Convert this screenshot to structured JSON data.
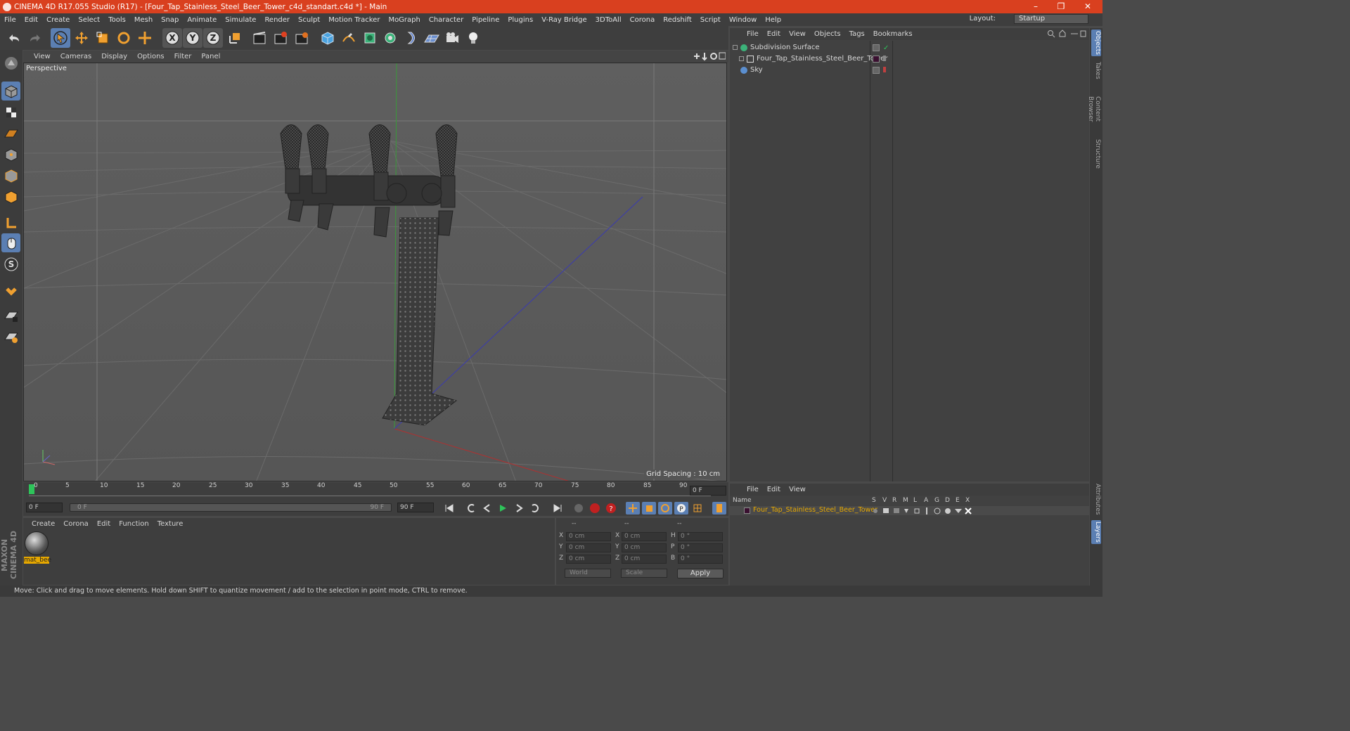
{
  "titlebar": {
    "title": "CINEMA 4D R17.055 Studio (R17) - [Four_Tap_Stainless_Steel_Beer_Tower_c4d_standart.c4d *] - Main",
    "minimize": "–",
    "restore": "❐",
    "close": "✕"
  },
  "menubar": {
    "items": [
      "File",
      "Edit",
      "Create",
      "Select",
      "Tools",
      "Mesh",
      "Snap",
      "Animate",
      "Simulate",
      "Render",
      "Sculpt",
      "Motion Tracker",
      "MoGraph",
      "Character",
      "Pipeline",
      "Plugins",
      "V-Ray Bridge",
      "3DToAll",
      "Corona",
      "Redshift",
      "Script",
      "Window",
      "Help"
    ],
    "layout_label": "Layout:",
    "layout_value": "Startup"
  },
  "toolbar": {
    "axis_x": "X",
    "axis_y": "Y",
    "axis_z": "Z"
  },
  "viewport": {
    "menu": [
      "View",
      "Cameras",
      "Display",
      "Options",
      "Filter",
      "Panel"
    ],
    "label": "Perspective",
    "grid_spacing": "Grid Spacing : 10 cm"
  },
  "timeline": {
    "ticks": [
      "0",
      "5",
      "10",
      "15",
      "20",
      "25",
      "30",
      "35",
      "40",
      "45",
      "50",
      "55",
      "60",
      "65",
      "70",
      "75",
      "80",
      "85",
      "90"
    ],
    "current_frame": "0 F",
    "start_frame": "0 F",
    "range_start": "0 F",
    "range_end": "90 F",
    "end_frame": "90 F"
  },
  "material_manager": {
    "menu": [
      "Create",
      "Corona",
      "Edit",
      "Function",
      "Texture"
    ],
    "material_name": "mat_bee"
  },
  "coordinates": {
    "header_left": "--",
    "header_mid": "--",
    "header_right": "--",
    "rows": [
      {
        "l1": "X",
        "v1": "0 cm",
        "l2": "X",
        "v2": "0 cm",
        "l3": "H",
        "v3": "0 °"
      },
      {
        "l1": "Y",
        "v1": "0 cm",
        "l2": "Y",
        "v2": "0 cm",
        "l3": "P",
        "v3": "0 °"
      },
      {
        "l1": "Z",
        "v1": "0 cm",
        "l2": "Z",
        "v2": "0 cm",
        "l3": "B",
        "v3": "0 °"
      }
    ],
    "coord_system": "World",
    "mode": "Scale",
    "apply": "Apply"
  },
  "object_manager": {
    "menu": [
      "File",
      "Edit",
      "View",
      "Objects",
      "Tags",
      "Bookmarks"
    ],
    "objects": [
      {
        "name": "Subdivision Surface",
        "indent": 0
      },
      {
        "name": "Four_Tap_Stainless_Steel_Beer_Tower",
        "indent": 1
      },
      {
        "name": "Sky",
        "indent": 0
      }
    ]
  },
  "side_tabs": [
    "Objects",
    "Takes",
    "Content Browser",
    "Structure",
    "Attributes",
    "Layers"
  ],
  "layer_manager": {
    "menu": [
      "File",
      "Edit",
      "View"
    ],
    "columns": [
      "Name",
      "S",
      "V",
      "R",
      "M",
      "L",
      "A",
      "G",
      "D",
      "E",
      "X"
    ],
    "layer_name": "Four_Tap_Stainless_Steel_Beer_Tower"
  },
  "statusbar": {
    "text": "Move: Click and drag to move elements. Hold down SHIFT to quantize movement / add to the selection in point mode, CTRL to remove."
  },
  "brand": {
    "text": "MAXON CINEMA 4D"
  },
  "colors": {
    "accent": "#d9401f",
    "selection": "#5b7fb3",
    "highlight": "#e6a800"
  }
}
